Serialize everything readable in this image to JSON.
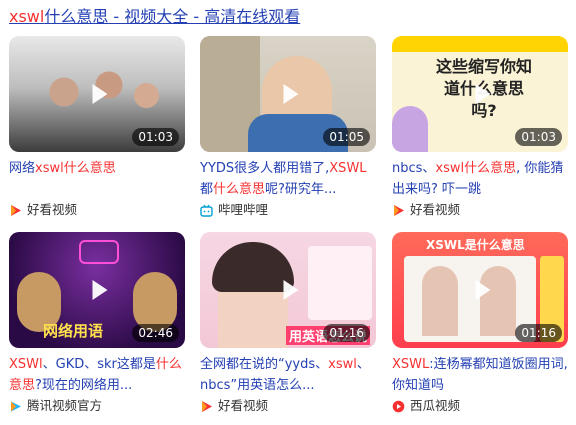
{
  "header": {
    "query": "xswl",
    "rest": "什么意思 - 视频大全 - 高清在线观看"
  },
  "cards": [
    {
      "duration": "01:03",
      "caption_a": "网络",
      "caption_b": "xswl什么意思",
      "caption_c": "",
      "source": "好看视频",
      "source_icon": "haokan-icon"
    },
    {
      "duration": "01:05",
      "caption_a": "YYDS很多人都用错了,",
      "caption_b": "XSWL",
      "caption_c": "都",
      "caption_d": "什么意思",
      "caption_e": "呢?研究年...",
      "source": "哔哩哔哩",
      "source_icon": "bilibili-icon"
    },
    {
      "duration": "01:03",
      "caption_a": "nbcs、",
      "caption_b": "xswl什么意思",
      "caption_c": ", 你能猜出来吗? 吓一跳",
      "source": "好看视频",
      "source_icon": "haokan-icon",
      "thumb_text": "这些缩写你知道什么意思吗?"
    },
    {
      "duration": "02:46",
      "caption_a": "XSWl",
      "caption_b": "、GKD、skr这都是",
      "caption_c": "什么意思",
      "caption_d": "?现在的网络用...",
      "source": "腾讯视频官方",
      "source_icon": "tencent-video-icon",
      "thumb_text": "网络用语"
    },
    {
      "duration": "01:16",
      "caption_a": "全网都在说的“yyds、",
      "caption_b": "xswl",
      "caption_c": "、nbcs”用英语怎么...",
      "source": "好看视频",
      "source_icon": "haokan-icon",
      "thumb_text": "用英语怎么说"
    },
    {
      "duration": "01:16",
      "caption_a": "XSWL",
      "caption_b": ":连杨幂都知道饭圈用词,你知道吗",
      "caption_c": "",
      "source": "西瓜视频",
      "source_icon": "xigua-icon",
      "thumb_text": "XSWL是什么意思"
    }
  ]
}
